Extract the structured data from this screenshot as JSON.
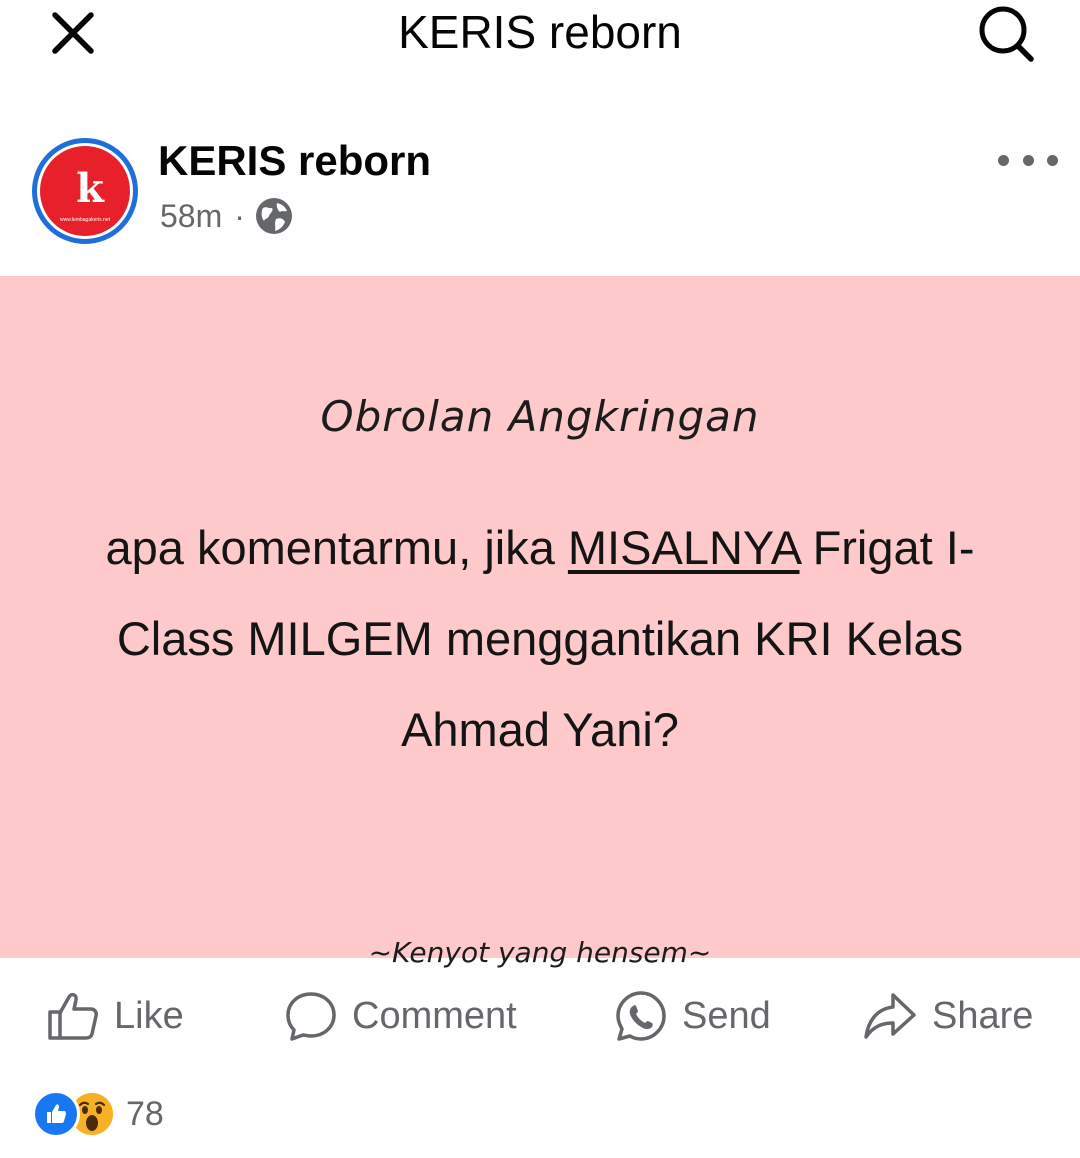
{
  "topbar": {
    "title": "KERIS reborn",
    "close_icon": "close-icon",
    "search_icon": "search-icon"
  },
  "post": {
    "page_name": "KERIS reborn",
    "time": "58m",
    "separator": "·",
    "audience_icon": "globe-icon",
    "more_icon": "more-horizontal-icon",
    "avatar_letter": "k",
    "avatar_caption": "www.lembagakeris.net",
    "image": {
      "title": "Obrolan Angkringan",
      "body_part1": "apa komentarmu, jika ",
      "body_highlight": "MISALNYA",
      "body_part2": " Frigat I-Class MILGEM menggantikan KRI Kelas Ahmad Yani?",
      "signature": "~Kenyot yang hensem~",
      "background": "#fdc9cb"
    }
  },
  "actions": {
    "like": "Like",
    "comment": "Comment",
    "send": "Send",
    "share": "Share"
  },
  "reactions": {
    "count": "78",
    "types": [
      "like",
      "wow"
    ]
  },
  "colors": {
    "accent": "#1877f2",
    "secondary_text": "#65676b",
    "avatar_red": "#e8202a"
  }
}
